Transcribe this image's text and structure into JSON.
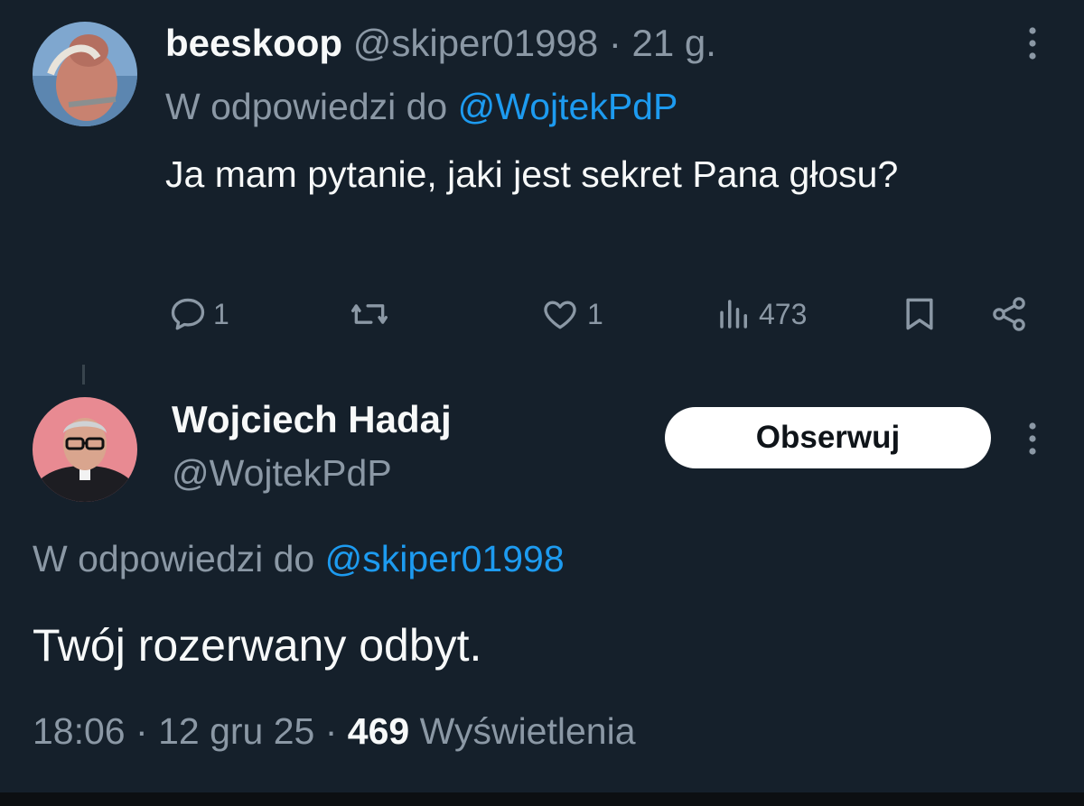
{
  "reply_tweet": {
    "display_name": "beeskoop",
    "handle": "@skiper01998",
    "separator": "·",
    "age": "21 g.",
    "reply_prefix": "W odpowiedzi do",
    "reply_to_handle": "@WojtekPdP",
    "text": "Ja mam pytanie, jaki jest sekret Pana głosu?",
    "actions": {
      "reply_count": "1",
      "retweet_count": "",
      "like_count": "1",
      "views_count": "473"
    },
    "icons": [
      "more-icon",
      "reply-icon",
      "retweet-icon",
      "like-icon",
      "views-icon",
      "bookmark-icon",
      "share-icon"
    ]
  },
  "main_tweet": {
    "display_name": "Wojciech Hadaj",
    "handle": "@WojtekPdP",
    "follow_label": "Obserwuj",
    "reply_prefix": "W odpowiedzi do",
    "reply_to_handle": "@skiper01998",
    "text": "Twój rozerwany odbyt.",
    "time": "18:06",
    "separator": "·",
    "date": "12 gru 25",
    "views_count": "469",
    "views_label": "Wyświetlenia"
  },
  "colors": {
    "background": "#15202b",
    "text_primary": "#f7f9f9",
    "text_secondary": "#8b98a5",
    "accent": "#1d9bf0",
    "button_bg": "#ffffff"
  }
}
